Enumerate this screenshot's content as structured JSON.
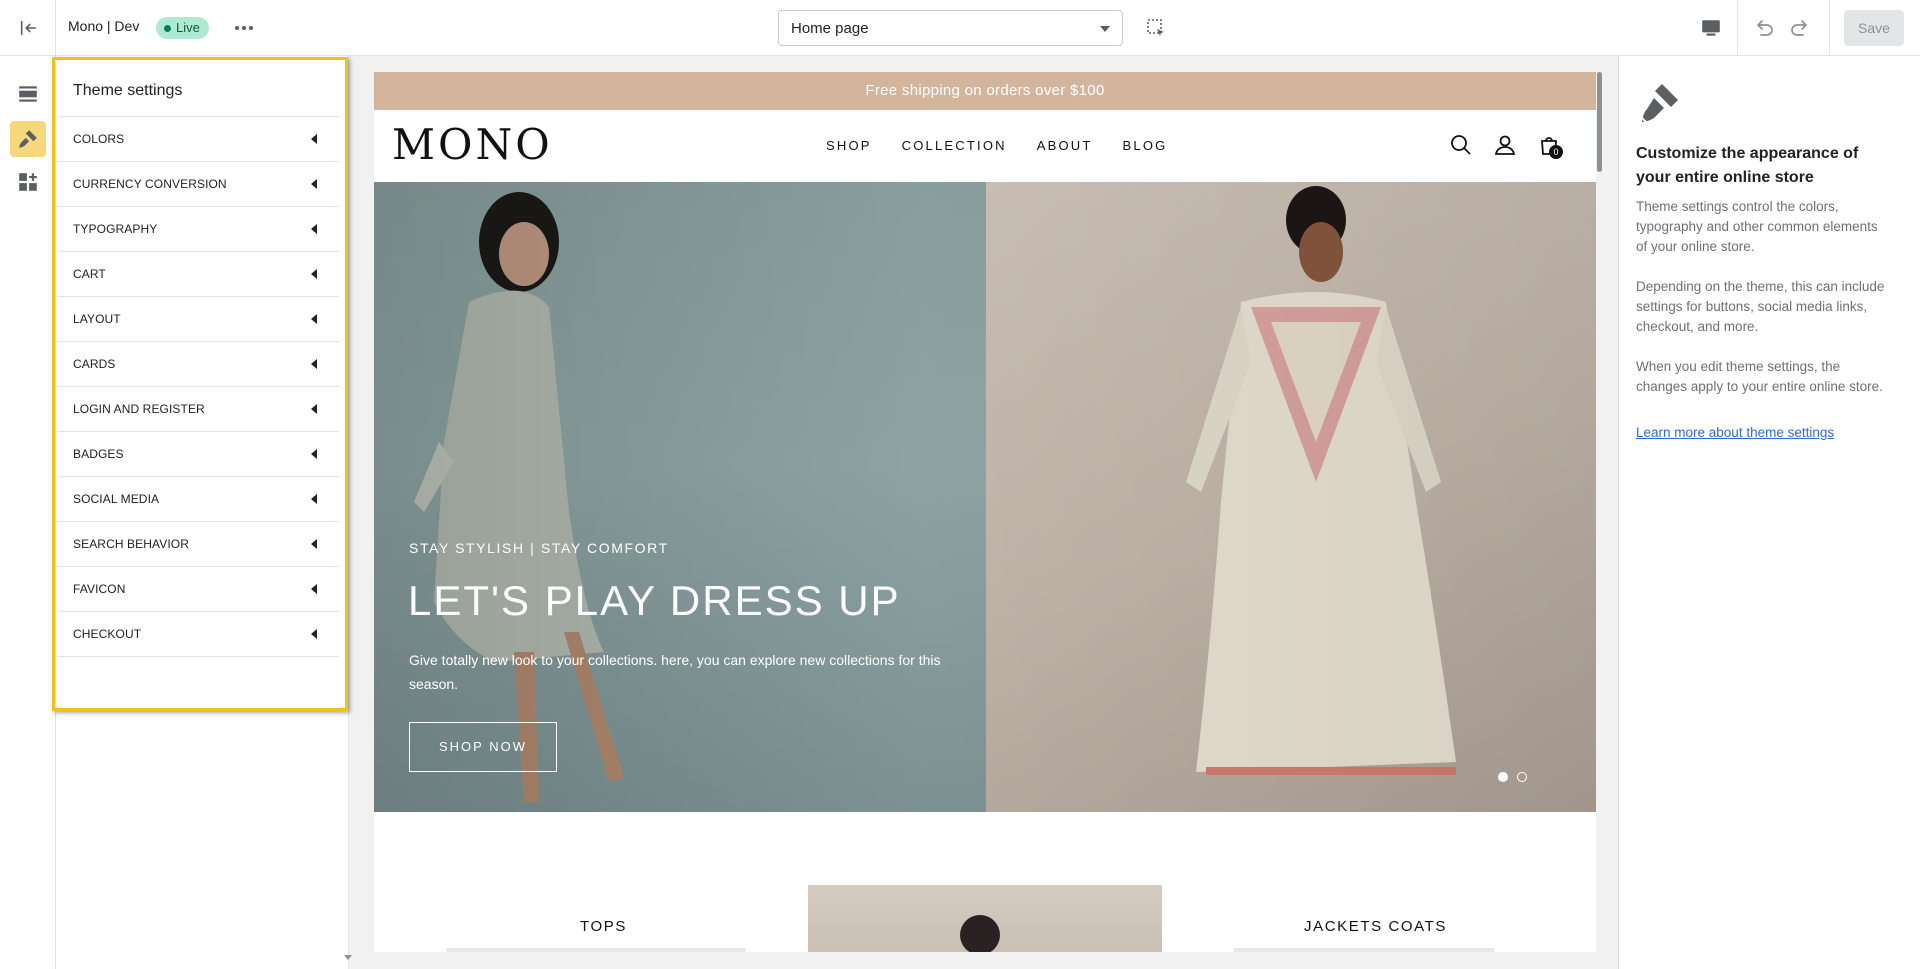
{
  "topbar": {
    "store_name": "Mono | Dev",
    "status_badge": "Live",
    "template_select": "Home page",
    "save_label": "Save"
  },
  "theme_settings": {
    "title": "Theme settings",
    "items": [
      {
        "label": "COLORS"
      },
      {
        "label": "CURRENCY CONVERSION"
      },
      {
        "label": "TYPOGRAPHY"
      },
      {
        "label": "CART"
      },
      {
        "label": "LAYOUT"
      },
      {
        "label": "CARDS"
      },
      {
        "label": "LOGIN AND REGISTER"
      },
      {
        "label": "BADGES"
      },
      {
        "label": "SOCIAL MEDIA"
      },
      {
        "label": "SEARCH BEHAVIOR"
      },
      {
        "label": "FAVICON"
      },
      {
        "label": "CHECKOUT"
      }
    ]
  },
  "preview": {
    "announcement": "Free shipping on orders over $100",
    "logo": "MONO",
    "nav": [
      "SHOP",
      "COLLECTION",
      "ABOUT",
      "BLOG"
    ],
    "cart_count": "0",
    "hero": {
      "subtitle": "STAY STYLISH | STAY COMFORT",
      "title": "LET'S PLAY DRESS UP",
      "text": "Give totally new look to your collections. here, you can explore new collections for this season.",
      "button": "SHOP NOW"
    },
    "collections": [
      "TOPS",
      "JACKETS COATS"
    ]
  },
  "info_panel": {
    "title": "Customize the appearance of your entire online store",
    "p1": "Theme settings control the colors, typography and other common elements of your online store.",
    "p2": "Depending on the theme, this can include settings for buttons, social media links, checkout, and more.",
    "p3": "When you edit theme settings, the changes apply to your entire online store.",
    "link": "Learn more about theme settings"
  },
  "colors": {
    "highlight": "#f2c214",
    "announcement_bg": "#d3b49d",
    "live_badge_bg": "#aee9d1",
    "link": "#2c6ecb"
  },
  "icons": [
    "exit-icon",
    "more-icon",
    "inspector-icon",
    "desktop-icon",
    "undo-icon",
    "redo-icon",
    "sections-icon",
    "theme-settings-icon",
    "app-embeds-icon",
    "search-icon",
    "account-icon",
    "cart-icon",
    "paintbrush-icon"
  ]
}
